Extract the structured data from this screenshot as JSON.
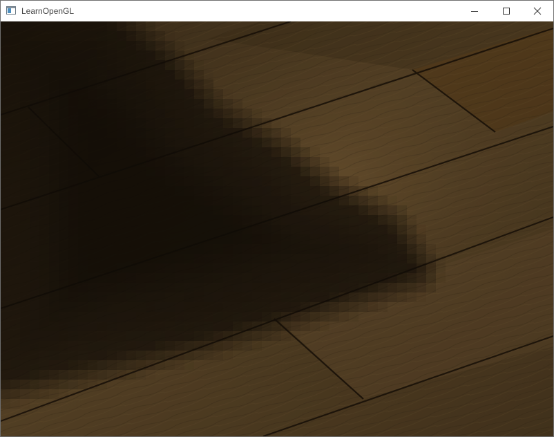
{
  "window": {
    "title": "LearnOpenGL",
    "controls": {
      "minimize": "minimize",
      "maximize": "maximize",
      "close": "close"
    }
  },
  "icons": {
    "app": "window-app-icon",
    "minimize": "minimize-icon",
    "maximize": "maximize-icon",
    "close": "close-icon"
  },
  "colors": {
    "titlebar_bg": "#ffffff",
    "title_text": "#444444",
    "wood_light": "#6b5232",
    "wood_mid": "#4b3920",
    "wood_dark": "#2a1f12",
    "seam": "#1c1309",
    "shadow": "#120d07"
  }
}
